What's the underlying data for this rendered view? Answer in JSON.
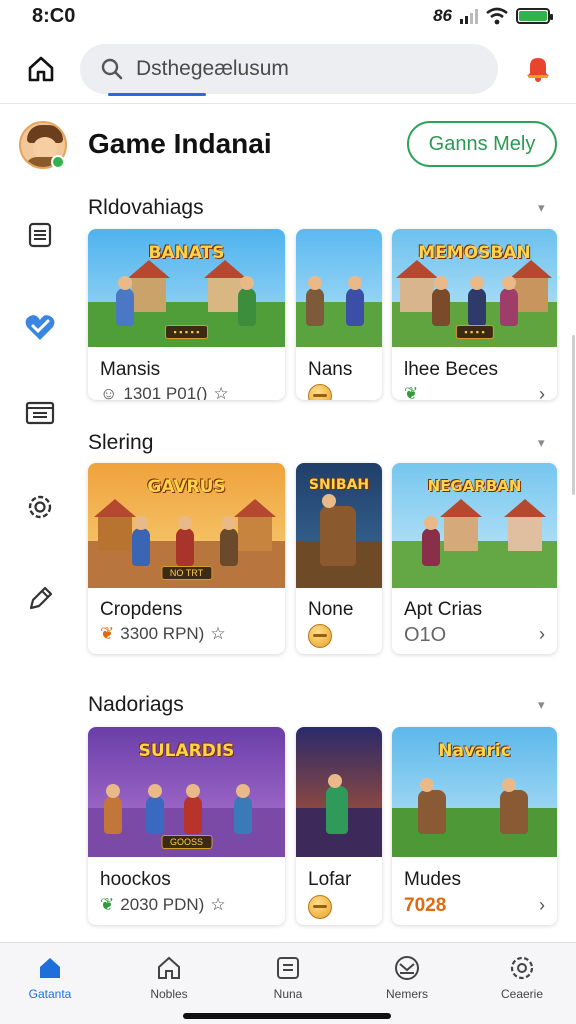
{
  "status_bar": {
    "time": "8:C0",
    "network": "86"
  },
  "search": {
    "placeholder": "Dsthegeælusum"
  },
  "header": {
    "title": "Game Indanai",
    "action_label": "Ganns Mely"
  },
  "colors": {
    "accent": "#1e6fd9",
    "green": "#2fa35a",
    "orange": "#e06a10"
  },
  "sections": [
    {
      "title": "Rldovahiags",
      "cards": [
        {
          "name": "Mansis",
          "meta": "1301 P01()",
          "logo": "BANATS",
          "banner": "▪ ▪ ▪ ▪ ▪"
        },
        {
          "name": "Nans",
          "meta": "",
          "logo": "",
          "banner": ""
        },
        {
          "name": "lhee Beces",
          "meta": "",
          "logo": "MEMOSBAN",
          "banner": "▪ ▪ ▪ ▪"
        }
      ]
    },
    {
      "title": "Slering",
      "cards": [
        {
          "name": "Cropdens",
          "meta": "3300 RPN)",
          "logo": "GAVRUS",
          "banner": "NO TRT"
        },
        {
          "name": "None",
          "meta": "",
          "logo": "SNIBAH",
          "banner": ""
        },
        {
          "name": "Apt Crias",
          "meta": "O1O",
          "logo": "NEGARBAN",
          "banner": ""
        }
      ]
    },
    {
      "title": "Nadoriags",
      "cards": [
        {
          "name": "hoockos",
          "meta": "2030 PDN)",
          "logo": "SULARDIS",
          "banner": "GOOSS"
        },
        {
          "name": "Lofar",
          "meta": "",
          "logo": "",
          "banner": ""
        },
        {
          "name": "Mudes",
          "meta": "7028",
          "logo": "Navaric",
          "banner": ""
        }
      ]
    }
  ],
  "bottom_nav": [
    {
      "label": "Gatanta",
      "icon": "home-icon",
      "active": true
    },
    {
      "label": "Nobles",
      "icon": "home-outline-icon",
      "active": false
    },
    {
      "label": "Nuna",
      "icon": "list-icon",
      "active": false
    },
    {
      "label": "Nemers",
      "icon": "envelope-icon",
      "active": false
    },
    {
      "label": "Ceaerie",
      "icon": "gear-icon",
      "active": false
    }
  ]
}
